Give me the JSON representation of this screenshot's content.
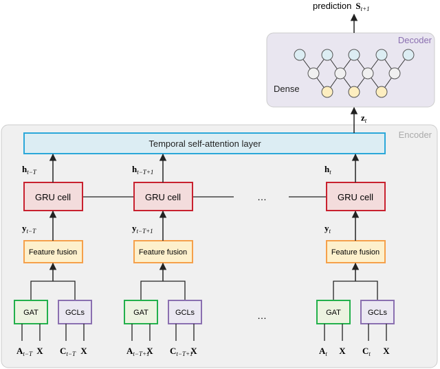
{
  "output": {
    "label": "prediction",
    "var": "S",
    "sub": "t+1"
  },
  "decoder": {
    "title": "Decoder",
    "dense_label": "Dense",
    "colors": {
      "top": "#dcedf3",
      "middle": "#f0f0f0",
      "bottom": "#fdeec0",
      "title": "#8a6fb0"
    }
  },
  "latent": {
    "var": "z",
    "sub": "t"
  },
  "encoder": {
    "title": "Encoder",
    "attention_label": "Temporal self-attention layer",
    "ellipsis": "…",
    "columns": [
      {
        "h": "h",
        "h_sub": "t−T",
        "gru": "GRU cell",
        "y": "y",
        "y_sub": "t−T",
        "fusion": "Feature fusion",
        "gat": "GAT",
        "gcl": "GCLs",
        "a": "A",
        "a_sub": "t−T",
        "x1": "X",
        "c": "C",
        "c_sub": "t−T",
        "x2": "X"
      },
      {
        "h": "h",
        "h_sub": "t−T+1",
        "gru": "GRU cell",
        "y": "y",
        "y_sub": "t−T+1",
        "fusion": "Feature fusion",
        "gat": "GAT",
        "gcl": "GCLs",
        "a": "A",
        "a_sub": "t−T+1",
        "x1": "X",
        "c": "C",
        "c_sub": "t−T+1",
        "x2": "X"
      },
      {
        "h": "h",
        "h_sub": "t",
        "gru": "GRU cell",
        "y": "y",
        "y_sub": "t",
        "fusion": "Feature fusion",
        "gat": "GAT",
        "gcl": "GCLs",
        "a": "A",
        "a_sub": "t",
        "x1": "X",
        "c": "C",
        "c_sub": "t",
        "x2": "X"
      }
    ],
    "colors": {
      "attention_fill": "#dcedf3",
      "attention_stroke": "#2aa7d9",
      "gru_fill": "#f3dcdc",
      "gru_stroke": "#c8202e",
      "fusion_fill": "#fdf0cc",
      "fusion_stroke": "#f5a04a",
      "gat_fill": "#ecf3e0",
      "gat_stroke": "#22b04b",
      "gcl_fill": "#ebe8f2",
      "gcl_stroke": "#8a6fb0"
    }
  }
}
